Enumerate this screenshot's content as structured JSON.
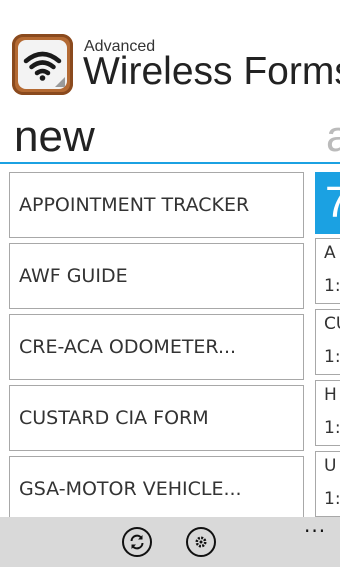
{
  "header": {
    "brand_small": "Advanced",
    "brand_big": "Wireless Forms",
    "logo_icon": "wifi-clipboard-icon"
  },
  "pivot": {
    "active_label": "new",
    "next_label": "a"
  },
  "forms": [
    {
      "label": "APPOINTMENT TRACKER"
    },
    {
      "label": "AWF GUIDE"
    },
    {
      "label": "CRE-ACA ODOMETER..."
    },
    {
      "label": "CUSTARD CIA FORM"
    },
    {
      "label": "GSA-MOTOR VEHICLE..."
    }
  ],
  "recent": {
    "tile_digit": "7",
    "items": [
      {
        "line1": "A",
        "line2": "1:"
      },
      {
        "line1": "CU",
        "line2": "1:"
      },
      {
        "line1": "H",
        "line2": "1:"
      },
      {
        "line1": "U",
        "line2": "1:"
      }
    ]
  },
  "appbar": {
    "ellipsis": "...",
    "buttons": [
      "sync-icon",
      "settings-icon"
    ]
  },
  "colors": {
    "accent": "#1ba1e2",
    "appbar_bg": "#d9d9d9",
    "logo_brown": "#b46a33"
  }
}
